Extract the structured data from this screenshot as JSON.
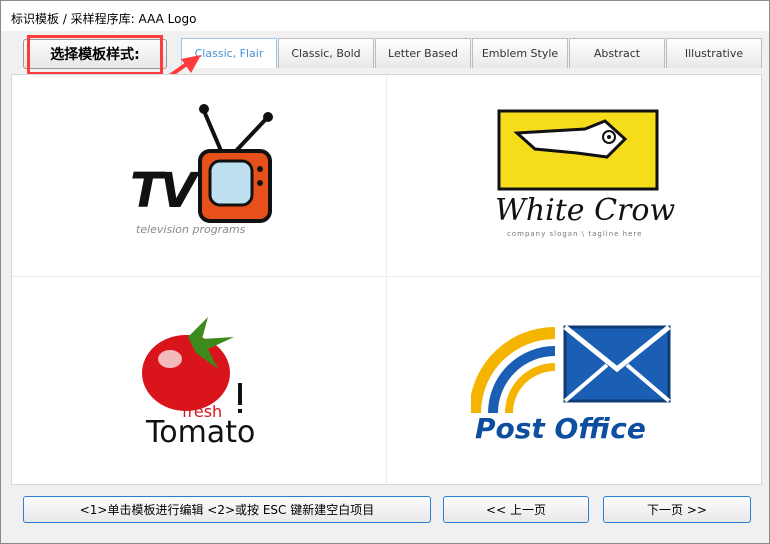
{
  "window": {
    "title": "标识模板 / 采样程序库: AAA Logo"
  },
  "toolbar": {
    "style_label": "选择模板样式:"
  },
  "tabs": [
    {
      "label": "Classic, Flair",
      "active": true
    },
    {
      "label": "Classic, Bold",
      "active": false
    },
    {
      "label": "Letter Based",
      "active": false
    },
    {
      "label": "Emblem Style",
      "active": false
    },
    {
      "label": "Abstract",
      "active": false
    },
    {
      "label": "Illustrative",
      "active": false
    }
  ],
  "logos": {
    "tv": {
      "title": "TV",
      "subtitle": "television programs"
    },
    "crow": {
      "title": "White Crow",
      "subtitle": "company slogan \\ tagline here"
    },
    "tomato": {
      "fresh": "fresh",
      "title": "Tomato"
    },
    "post": {
      "title": "Post Office"
    }
  },
  "buttons": {
    "edit": "<1>单击模板进行编辑  <2>或按 ESC 键新建空白项目",
    "prev": "<< 上一页",
    "next": "下一页 >>"
  },
  "colors": {
    "highlight": "#ff3b3b",
    "accent": "#4a90d9",
    "button_border": "#2a7fd0"
  }
}
